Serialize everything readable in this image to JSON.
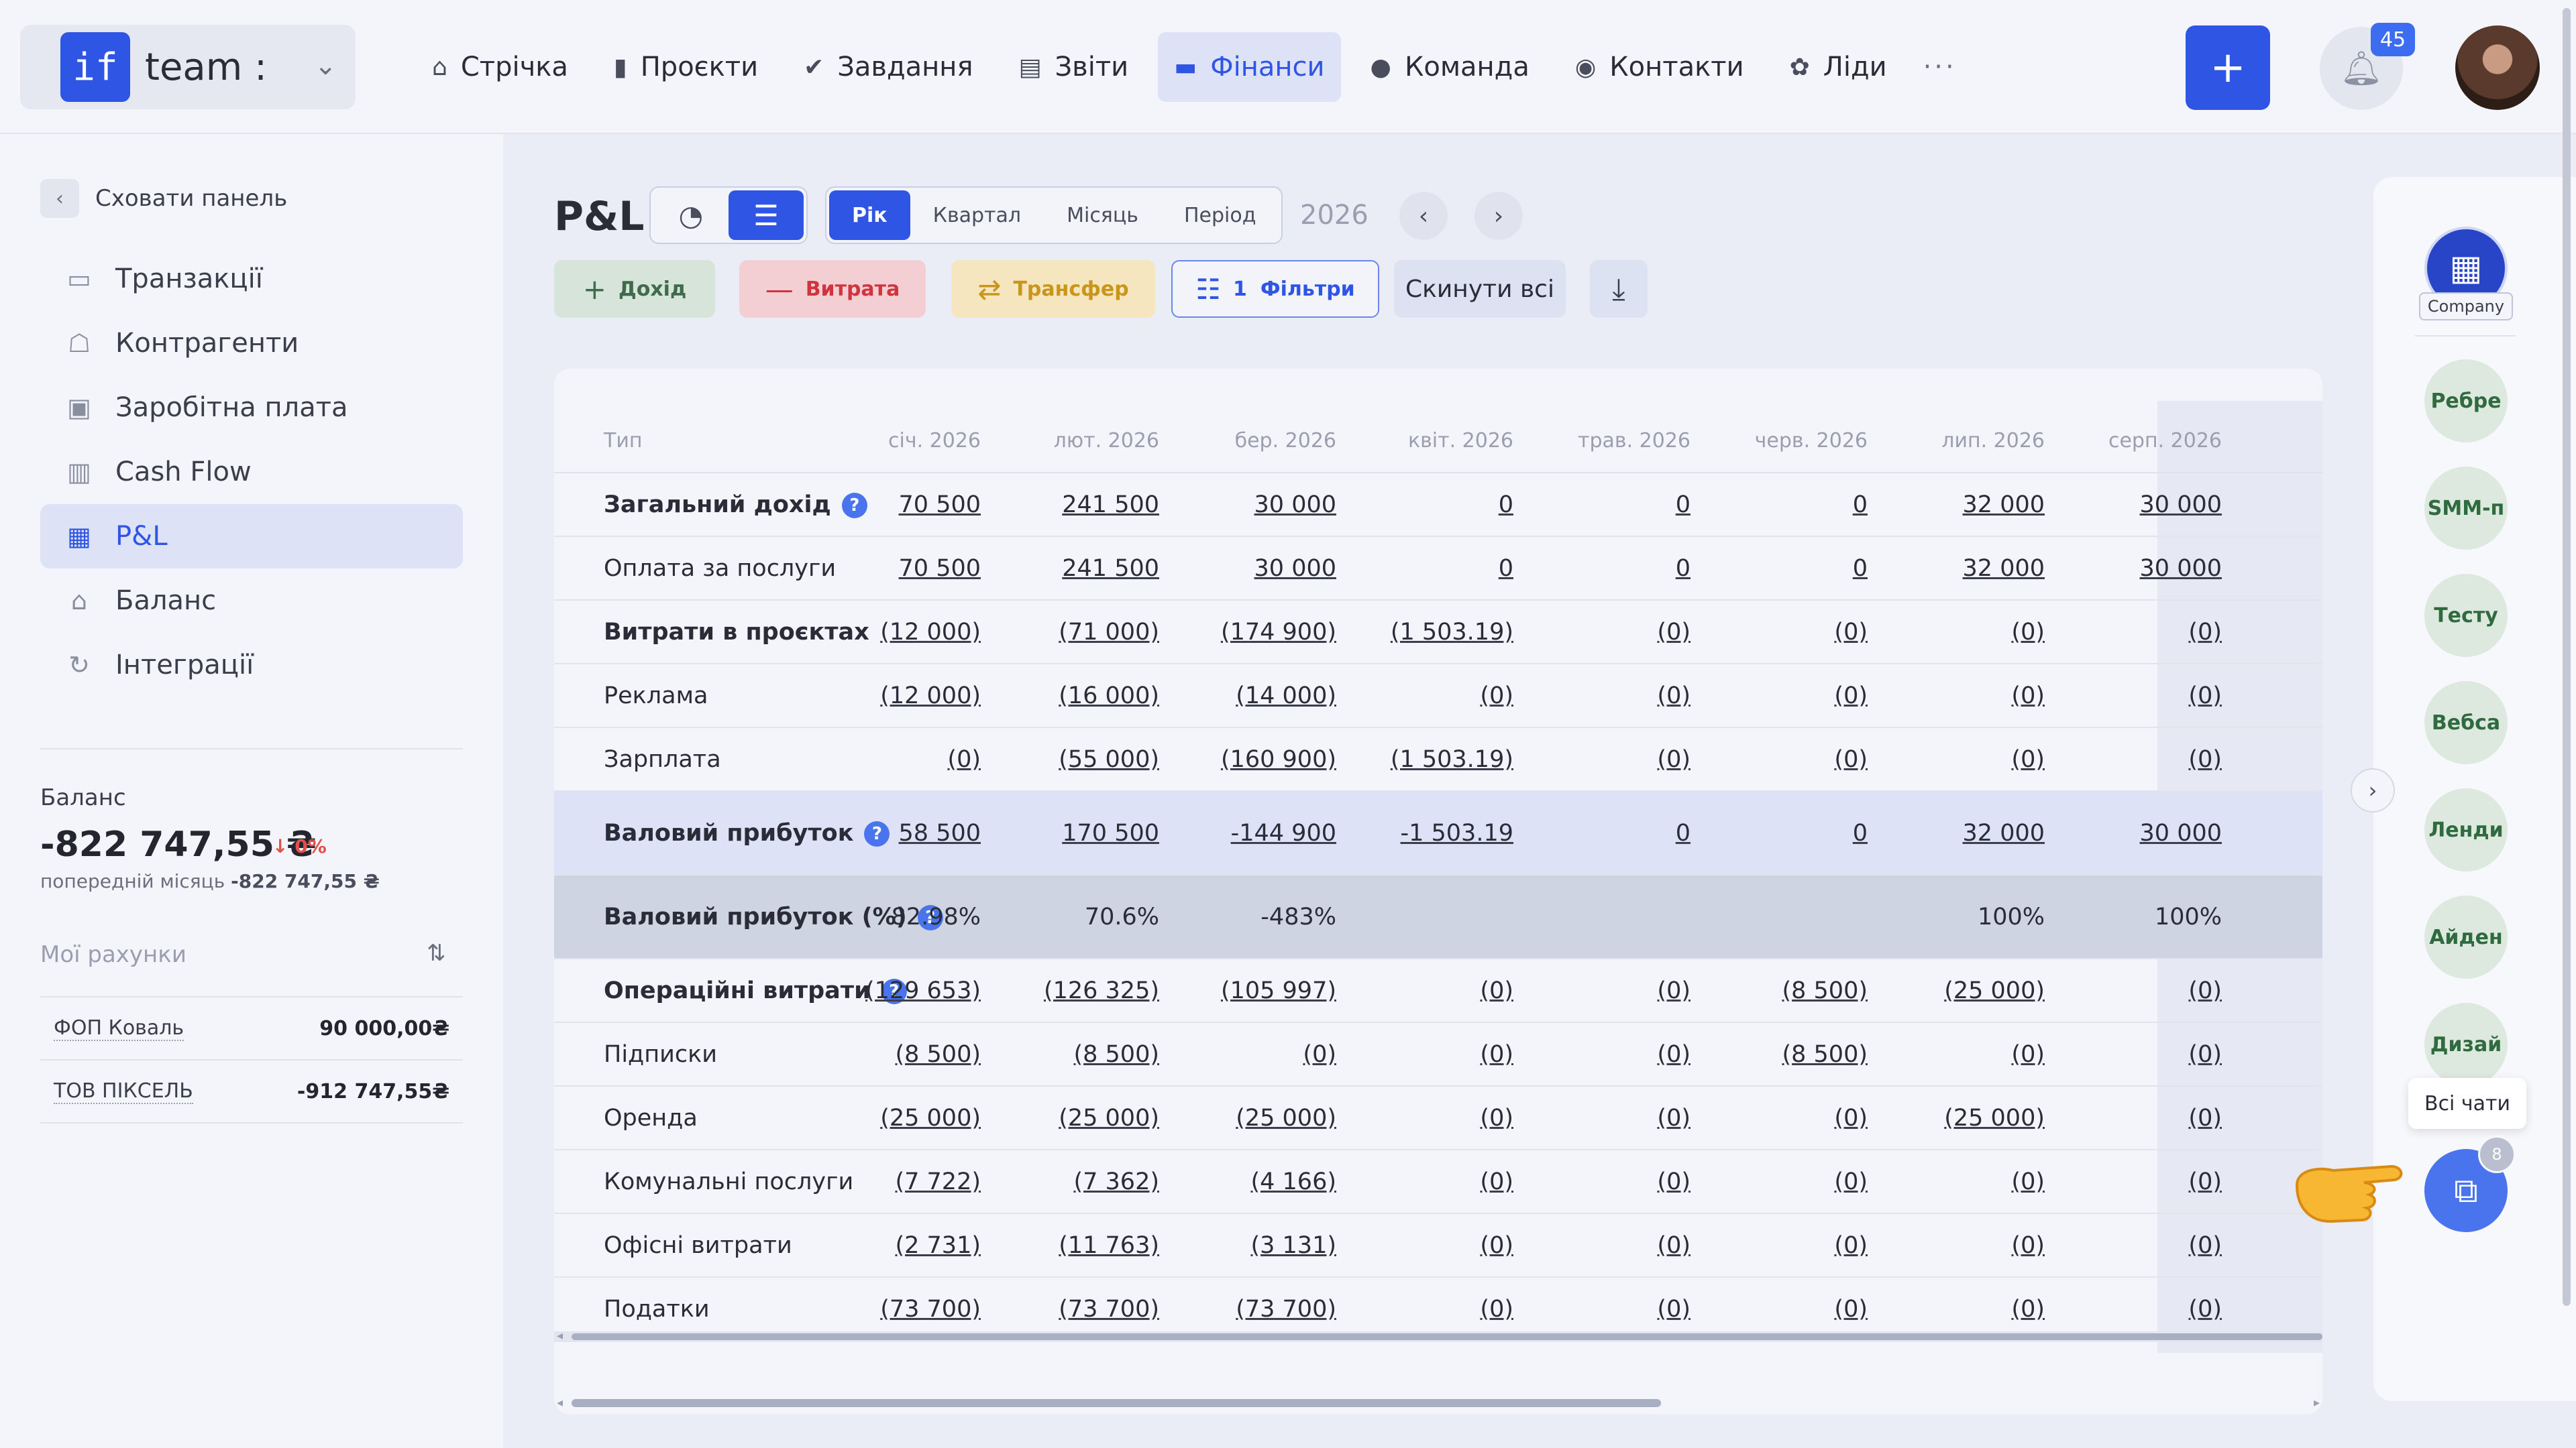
{
  "header": {
    "team_logo": "if",
    "team_name": "team :",
    "nav": [
      {
        "label": "Стрічка",
        "icon": "home-icon",
        "glyph": "⌂"
      },
      {
        "label": "Проєкти",
        "icon": "file-icon",
        "glyph": "▮"
      },
      {
        "label": "Завдання",
        "icon": "check-circle-icon",
        "glyph": "✔"
      },
      {
        "label": "Звіти",
        "icon": "report-icon",
        "glyph": "▤"
      },
      {
        "label": "Фінанси",
        "icon": "wallet-icon",
        "glyph": "▬"
      },
      {
        "label": "Команда",
        "icon": "person-icon",
        "glyph": "●"
      },
      {
        "label": "Контакти",
        "icon": "contacts-icon",
        "glyph": "◉"
      },
      {
        "label": "Ліди",
        "icon": "leads-icon",
        "glyph": "✿"
      }
    ],
    "active_nav": "Фінанси",
    "more": "···",
    "plus": "+",
    "notifications_count": "45"
  },
  "sidebar": {
    "hide_label": "Сховати панель",
    "items": [
      {
        "label": "Транзакції",
        "icon": "card-icon",
        "glyph": "▭"
      },
      {
        "label": "Контрагенти",
        "icon": "handshake-icon",
        "glyph": "☖"
      },
      {
        "label": "Заробітна плата",
        "icon": "briefcase-icon",
        "glyph": "▣"
      },
      {
        "label": "Cash Flow",
        "icon": "bar-chart-icon",
        "glyph": "▥"
      },
      {
        "label": "P&L",
        "icon": "calendar-dollar-icon",
        "glyph": "▦"
      },
      {
        "label": "Баланс",
        "icon": "bank-icon",
        "glyph": "⌂"
      },
      {
        "label": "Інтеграції",
        "icon": "sync-icon",
        "glyph": "↻"
      }
    ],
    "active_item": "P&L",
    "balance": {
      "title": "Баланс",
      "value": "-822 747,55 ₴",
      "change": "↓ 0%",
      "prev_label": "попередній місяць",
      "prev_value": "-822 747,55 ₴"
    },
    "accounts_title": "Мої рахунки",
    "accounts": [
      {
        "name": "ФОП Коваль",
        "value": "90 000,00₴"
      },
      {
        "name": "ТОВ ПІКСЕЛЬ",
        "value": "-912 747,55₴"
      }
    ]
  },
  "main": {
    "title": "P&L",
    "period_tabs": [
      "Рік",
      "Квартал",
      "Місяць",
      "Період"
    ],
    "active_period": "Рік",
    "year": "2026",
    "actions": {
      "income": "Дохід",
      "expense": "Витрата",
      "transfer": "Трансфер",
      "filters_count": "1",
      "filters": "Фільтри",
      "reset": "Скинути всі"
    },
    "table": {
      "type_header": "Тип",
      "months": [
        "січ. 2026",
        "лют. 2026",
        "бер. 2026",
        "квіт. 2026",
        "трав. 2026",
        "черв. 2026",
        "лип. 2026",
        "серп. 2026"
      ],
      "rows": [
        {
          "label": "Загальний дохід",
          "bold": true,
          "help": true,
          "style": "",
          "underline": true,
          "values": [
            "70 500",
            "241 500",
            "30 000",
            "0",
            "0",
            "0",
            "32 000",
            "30 000"
          ]
        },
        {
          "label": "Оплата за послуги",
          "bold": false,
          "help": false,
          "style": "",
          "underline": true,
          "values": [
            "70 500",
            "241 500",
            "30 000",
            "0",
            "0",
            "0",
            "32 000",
            "30 000"
          ]
        },
        {
          "label": "Витрати в проєктах",
          "bold": true,
          "help": false,
          "style": "",
          "underline": true,
          "values": [
            "(12 000)",
            "(71 000)",
            "(174 900)",
            "(1 503.19)",
            "(0)",
            "(0)",
            "(0)",
            "(0)"
          ]
        },
        {
          "label": "Реклама",
          "bold": false,
          "help": false,
          "style": "",
          "underline": true,
          "values": [
            "(12 000)",
            "(16 000)",
            "(14 000)",
            "(0)",
            "(0)",
            "(0)",
            "(0)",
            "(0)"
          ]
        },
        {
          "label": "Зарплата",
          "bold": false,
          "help": false,
          "style": "",
          "underline": true,
          "values": [
            "(0)",
            "(55 000)",
            "(160 900)",
            "(1 503.19)",
            "(0)",
            "(0)",
            "(0)",
            "(0)"
          ]
        },
        {
          "label": "Валовий прибуток",
          "bold": true,
          "help": true,
          "style": "gross",
          "underline": true,
          "values": [
            "58 500",
            "170 500",
            "-144 900",
            "-1 503.19",
            "0",
            "0",
            "32 000",
            "30 000"
          ]
        },
        {
          "label": "Валовий прибуток (%)",
          "bold": true,
          "help": true,
          "style": "grosspct",
          "underline": false,
          "values": [
            "82.98%",
            "70.6%",
            "-483%",
            "",
            "",
            "",
            "100%",
            "100%"
          ]
        },
        {
          "label": "Операційні витрати",
          "bold": true,
          "help": true,
          "style": "",
          "underline": true,
          "values": [
            "(129 653)",
            "(126 325)",
            "(105 997)",
            "(0)",
            "(0)",
            "(8 500)",
            "(25 000)",
            "(0)"
          ]
        },
        {
          "label": "Підписки",
          "bold": false,
          "help": false,
          "style": "",
          "underline": true,
          "values": [
            "(8 500)",
            "(8 500)",
            "(0)",
            "(0)",
            "(0)",
            "(8 500)",
            "(0)",
            "(0)"
          ]
        },
        {
          "label": "Оренда",
          "bold": false,
          "help": false,
          "style": "",
          "underline": true,
          "values": [
            "(25 000)",
            "(25 000)",
            "(25 000)",
            "(0)",
            "(0)",
            "(0)",
            "(25 000)",
            "(0)"
          ]
        },
        {
          "label": "Комунальні послуги",
          "bold": false,
          "help": false,
          "style": "",
          "underline": true,
          "values": [
            "(7 722)",
            "(7 362)",
            "(4 166)",
            "(0)",
            "(0)",
            "(0)",
            "(0)",
            "(0)"
          ]
        },
        {
          "label": "Офісні витрати",
          "bold": false,
          "help": false,
          "style": "",
          "underline": true,
          "values": [
            "(2 731)",
            "(11 763)",
            "(3 131)",
            "(0)",
            "(0)",
            "(0)",
            "(0)",
            "(0)"
          ]
        },
        {
          "label": "Податки",
          "bold": false,
          "help": false,
          "style": "",
          "underline": true,
          "values": [
            "(73 700)",
            "(73 700)",
            "(73 700)",
            "(0)",
            "(0)",
            "(0)",
            "(0)",
            "(0)"
          ]
        }
      ]
    }
  },
  "right_panel": {
    "company_label": "Company",
    "chats": [
      "Ребре",
      "SMM-п",
      "Тесту",
      "Вебса",
      "Ленди",
      "Айден",
      "Дизай"
    ],
    "all_chats_tooltip": "Всі чати",
    "all_chats_count": "8"
  }
}
